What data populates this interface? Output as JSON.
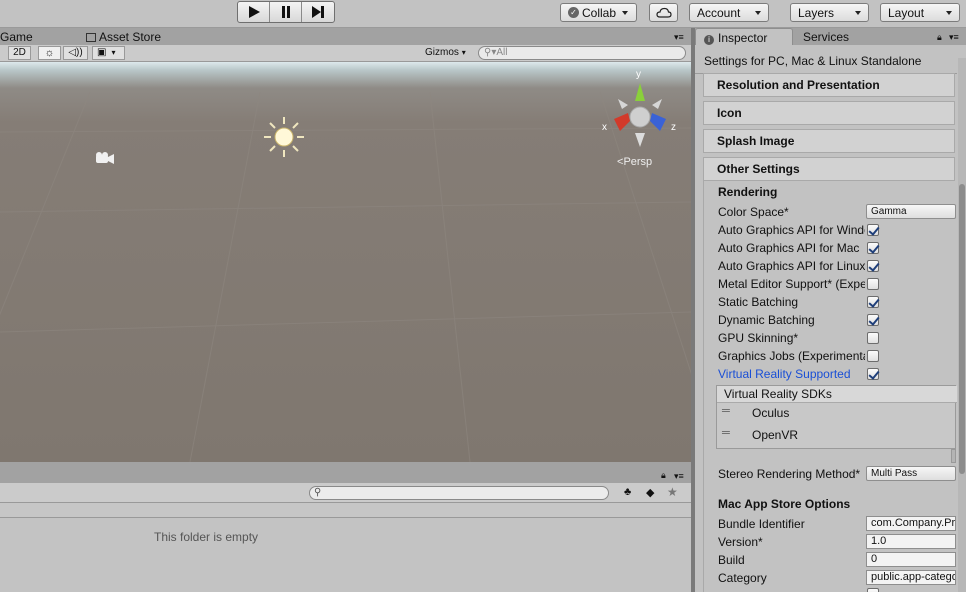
{
  "toolbar": {
    "play_icon": "play-icon",
    "pause_icon": "pause-icon",
    "step_icon": "step-icon",
    "collab_label": "Collab",
    "cloud_icon": "cloud-icon",
    "account_label": "Account",
    "layers_label": "Layers",
    "layout_label": "Layout"
  },
  "scene": {
    "tab_game": "Game",
    "tab_asset_store": "Asset Store",
    "mode_2d": "2D",
    "gizmos_label": "Gizmos",
    "search_placeholder": "All",
    "persp_label": "Persp",
    "gizmo_axes": {
      "y": "y",
      "x": "x",
      "z": "z"
    }
  },
  "project": {
    "empty_message": "This folder is empty"
  },
  "inspector": {
    "tab_inspector": "Inspector",
    "tab_services": "Services",
    "settings_title": "Settings for PC, Mac & Linux Standalone",
    "sections": {
      "resolution": "Resolution and Presentation",
      "icon": "Icon",
      "splash": "Splash Image",
      "other": "Other Settings"
    },
    "rendering_heading": "Rendering",
    "color_space_label": "Color Space*",
    "color_space_value": "Gamma",
    "checkbox_rows": [
      {
        "label": "Auto Graphics API for Windows",
        "checked": true
      },
      {
        "label": "Auto Graphics API for Mac",
        "checked": true
      },
      {
        "label": "Auto Graphics API for Linux",
        "checked": true
      },
      {
        "label": "Metal Editor Support* (Experimental)",
        "checked": false
      },
      {
        "label": "Static Batching",
        "checked": true
      },
      {
        "label": "Dynamic Batching",
        "checked": true
      },
      {
        "label": "GPU Skinning*",
        "checked": false
      },
      {
        "label": "Graphics Jobs (Experimental)",
        "checked": false
      },
      {
        "label": "Virtual Reality Supported",
        "checked": true
      }
    ],
    "vr_sdks_title": "Virtual Reality SDKs",
    "vr_sdks": [
      "Oculus",
      "OpenVR"
    ],
    "stereo_label": "Stereo Rendering Method*",
    "stereo_value": "Multi Pass",
    "mac_store_heading": "Mac App Store Options",
    "bundle_id_label": "Bundle Identifier",
    "bundle_id_value": "com.Company.ProductName",
    "version_label": "Version*",
    "version_value": "1.0",
    "build_label": "Build",
    "build_value": "0",
    "category_label": "Category",
    "category_value": "public.app-category.games",
    "vr_color": "#1a4fd6"
  }
}
